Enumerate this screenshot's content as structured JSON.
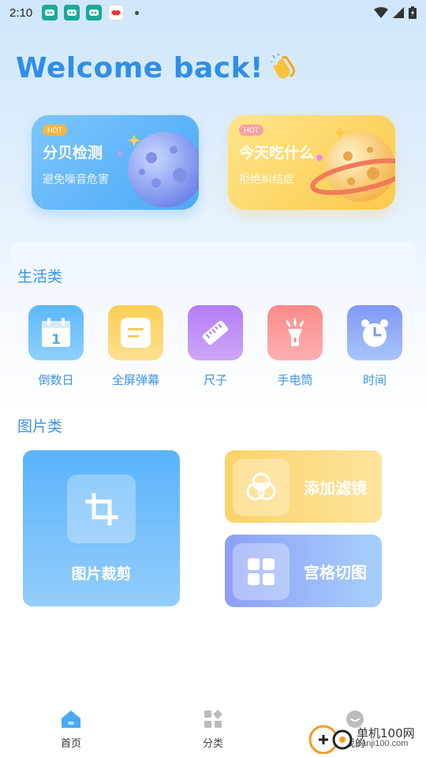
{
  "status_bar": {
    "time": "2:10"
  },
  "welcome": {
    "title": "Welcome back!"
  },
  "hot_cards": [
    {
      "badge": "HOT",
      "title": "分贝检测",
      "subtitle": "避免噪音危害"
    },
    {
      "badge": "HOT",
      "title": "今天吃什么",
      "subtitle": "拒绝纠结症"
    }
  ],
  "life_section": {
    "title": "生活类",
    "tools": [
      {
        "label": "倒数日",
        "icon": "calendar-icon",
        "calendar_day": "1"
      },
      {
        "label": "全屏弹幕",
        "icon": "text-lines-icon"
      },
      {
        "label": "尺子",
        "icon": "ruler-icon"
      },
      {
        "label": "手电筒",
        "icon": "flashlight-icon"
      },
      {
        "label": "时间",
        "icon": "alarm-clock-icon"
      }
    ]
  },
  "image_section": {
    "title": "图片类",
    "tools": [
      {
        "label": "图片裁剪",
        "icon": "crop-icon"
      },
      {
        "label": "添加滤镜",
        "icon": "filter-circles-icon"
      },
      {
        "label": "宫格切图",
        "icon": "grid-icon"
      }
    ]
  },
  "tab_bar": {
    "tabs": [
      {
        "label": "首页",
        "icon": "home-icon",
        "active": true
      },
      {
        "label": "分类",
        "icon": "category-icon",
        "active": false
      },
      {
        "label": "我的",
        "icon": "profile-icon",
        "active": false
      }
    ]
  },
  "watermark": {
    "name": "单机100网",
    "url": "danji100.com"
  },
  "colors": {
    "accent": "#3a95e6",
    "title_blue": "#2f8ee8",
    "active_tab": "#3a95e6",
    "inactive_tab": "#555555"
  }
}
